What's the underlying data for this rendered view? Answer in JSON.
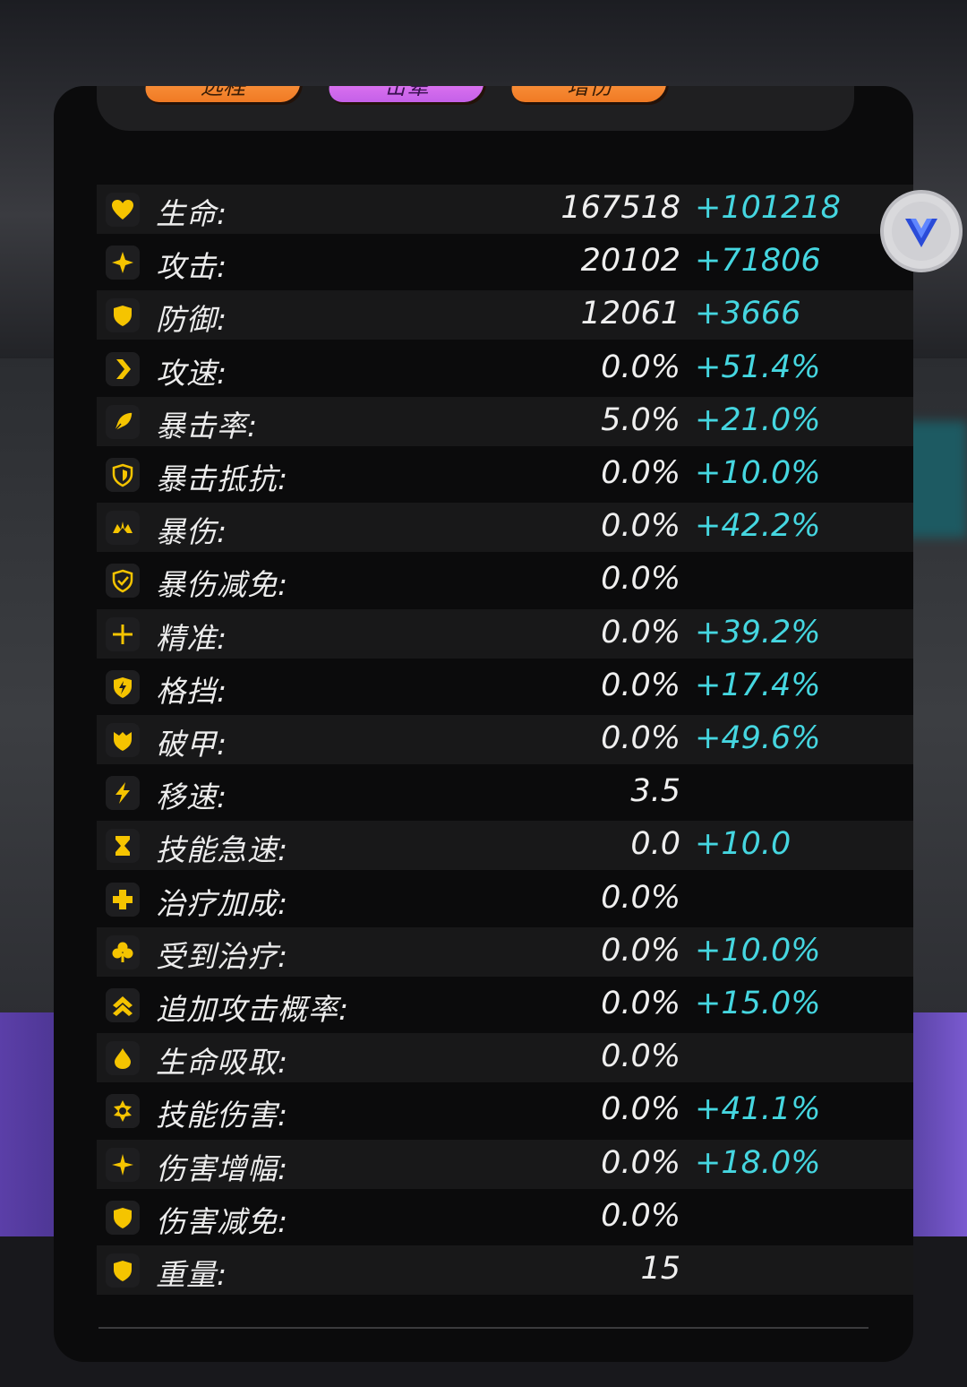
{
  "tags": [
    {
      "label": "远程",
      "color": "orange"
    },
    {
      "label": "击晕",
      "color": "purple"
    },
    {
      "label": "增伤",
      "color": "orange"
    }
  ],
  "colors": {
    "accent_bonus": "#45d6e0",
    "icon_yellow": "#f5c400",
    "panel_bg": "#0b0b0c"
  },
  "stats": [
    {
      "label": "生命:",
      "base": "167518",
      "bonus": "+101218",
      "icon": "heart-icon"
    },
    {
      "label": "攻击:",
      "base": "20102",
      "bonus": "+71806",
      "icon": "sparkle-icon"
    },
    {
      "label": "防御:",
      "base": "12061",
      "bonus": "+3666",
      "icon": "shield-icon"
    },
    {
      "label": "攻速:",
      "base": "0.0%",
      "bonus": "+51.4%",
      "icon": "chevron-right-icon"
    },
    {
      "label": "暴击率:",
      "base": "5.0%",
      "bonus": "+21.0%",
      "icon": "blade-icon"
    },
    {
      "label": "暴击抵抗:",
      "base": "0.0%",
      "bonus": "+10.0%",
      "icon": "shield-outline-icon"
    },
    {
      "label": "暴伤:",
      "base": "0.0%",
      "bonus": "+42.2%",
      "icon": "crown-icon"
    },
    {
      "label": "暴伤减免:",
      "base": "0.0%",
      "bonus": "",
      "icon": "shield-check-icon"
    },
    {
      "label": "精准:",
      "base": "0.0%",
      "bonus": "+39.2%",
      "icon": "crosshair-icon"
    },
    {
      "label": "格挡:",
      "base": "0.0%",
      "bonus": "+17.4%",
      "icon": "shield-bolt-icon"
    },
    {
      "label": "破甲:",
      "base": "0.0%",
      "bonus": "+49.6%",
      "icon": "broken-shield-icon"
    },
    {
      "label": "移速:",
      "base": "3.5",
      "bonus": "",
      "icon": "lightning-icon"
    },
    {
      "label": "技能急速:",
      "base": "0.0",
      "bonus": "+10.0",
      "icon": "hourglass-icon"
    },
    {
      "label": "治疗加成:",
      "base": "0.0%",
      "bonus": "",
      "icon": "medical-cross-icon"
    },
    {
      "label": "受到治疗:",
      "base": "0.0%",
      "bonus": "+10.0%",
      "icon": "clover-icon"
    },
    {
      "label": "追加攻击概率:",
      "base": "0.0%",
      "bonus": "+15.0%",
      "icon": "double-chevron-up-icon"
    },
    {
      "label": "生命吸取:",
      "base": "0.0%",
      "bonus": "",
      "icon": "drop-icon"
    },
    {
      "label": "技能伤害:",
      "base": "0.0%",
      "bonus": "+41.1%",
      "icon": "gear-star-icon"
    },
    {
      "label": "伤害增幅:",
      "base": "0.0%",
      "bonus": "+18.0%",
      "icon": "four-point-star-icon"
    },
    {
      "label": "伤害减免:",
      "base": "0.0%",
      "bonus": "",
      "icon": "shield-icon"
    },
    {
      "label": "重量:",
      "base": "15",
      "bonus": "",
      "icon": "shield-icon"
    }
  ],
  "float_button": {
    "icon": "v-logo-icon"
  }
}
